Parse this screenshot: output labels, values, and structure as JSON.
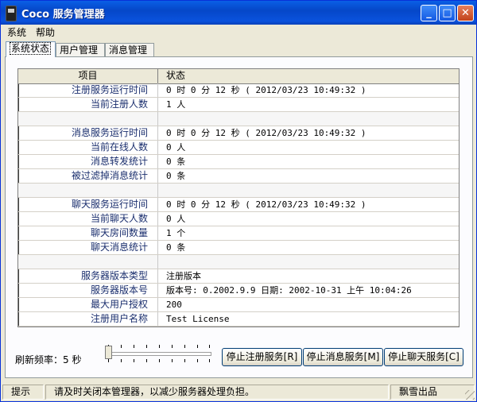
{
  "window": {
    "title": "Coco 服务管理器"
  },
  "titlebar_buttons": {
    "minimize": "_",
    "maximize": "□",
    "close": "✕"
  },
  "menu": [
    "系统",
    "帮助"
  ],
  "tabs": [
    "系统状态",
    "用户管理",
    "消息管理"
  ],
  "table": {
    "headers": [
      "项目",
      "状态"
    ],
    "rows": [
      {
        "key": "注册服务运行时间",
        "value": "0 时 0 分 12 秒 ( 2012/03/23 10:49:32 )"
      },
      {
        "key": "当前注册人数",
        "value": "1 人"
      },
      {
        "key": "",
        "value": ""
      },
      {
        "key": "消息服务运行时间",
        "value": "0 时 0 分 12 秒 ( 2012/03/23 10:49:32 )"
      },
      {
        "key": "当前在线人数",
        "value": "0 人"
      },
      {
        "key": "消息转发统计",
        "value": "0 条"
      },
      {
        "key": "被过滤掉消息统计",
        "value": "0 条"
      },
      {
        "key": "",
        "value": ""
      },
      {
        "key": "聊天服务运行时间",
        "value": "0 时 0 分 12 秒 ( 2012/03/23 10:49:32 )"
      },
      {
        "key": "当前聊天人数",
        "value": "0 人"
      },
      {
        "key": "聊天房间数量",
        "value": "1 个"
      },
      {
        "key": "聊天消息统计",
        "value": "0 条"
      },
      {
        "key": "",
        "value": ""
      },
      {
        "key": "服务器版本类型",
        "value": "注册版本"
      },
      {
        "key": "服务器版本号",
        "value": "版本号: 0.2002.9.9  日期: 2002-10-31 上午 10:04:26"
      },
      {
        "key": "最大用户授权",
        "value": "200"
      },
      {
        "key": "注册用户名称",
        "value": "Test License"
      }
    ]
  },
  "refresh": {
    "label": "刷新频率：5 秒",
    "slider_position": 0.0
  },
  "buttons": {
    "stop_register": "停止注册服务[R]",
    "stop_message": "停止消息服务[M]",
    "stop_chat": "停止聊天服务[C]"
  },
  "status": {
    "label": "提示",
    "message": "请及时关闭本管理器，以减少服务器处理负担。",
    "credit": "飘雪出品"
  }
}
